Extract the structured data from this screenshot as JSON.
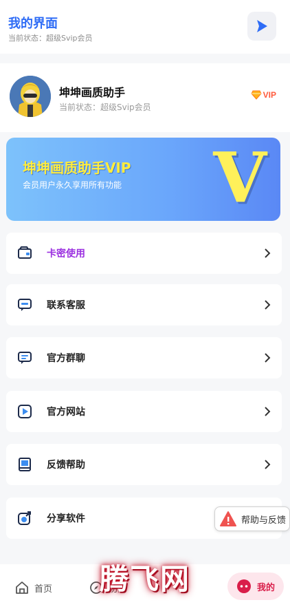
{
  "header": {
    "title": "我的界面",
    "subtitle": "当前状态：超级Svip会员",
    "play_icon": "play-icon"
  },
  "profile": {
    "name": "坤坤画质助手",
    "status": "当前状态：超级Svip会员",
    "vip_badge": "VIP"
  },
  "banner": {
    "title": "坤坤画质助手VIP",
    "subtitle": "会员用户永久享用所有功能",
    "big_letter": "V"
  },
  "menu": [
    {
      "label": "卡密使用",
      "icon": "card-icon",
      "accent": "#9b30e0"
    },
    {
      "label": "联系客服",
      "icon": "chat-icon"
    },
    {
      "label": "官方群聊",
      "icon": "group-chat-icon"
    },
    {
      "label": "官方网站",
      "icon": "website-play-icon"
    },
    {
      "label": "反馈帮助",
      "icon": "feedback-book-icon"
    },
    {
      "label": "分享软件",
      "icon": "share-icon"
    }
  ],
  "help_float": {
    "label": "帮助与反馈",
    "icon": "warning-icon"
  },
  "nav": {
    "home": "首页",
    "func": "功能",
    "mine": "我的"
  },
  "watermark": "腾飞网",
  "colors": {
    "accent_blue": "#2e6cf6",
    "purple": "#9b30e0",
    "mine_active": "#d91e4a"
  }
}
